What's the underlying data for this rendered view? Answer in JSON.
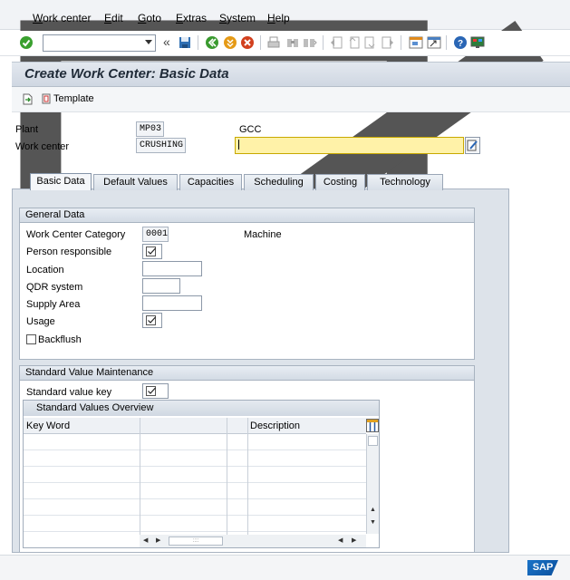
{
  "menu": {
    "items": [
      "Work center",
      "Edit",
      "Goto",
      "Extras",
      "System",
      "Help"
    ]
  },
  "toolbar": {
    "command_field_value": "",
    "icons": [
      "enter-icon",
      "command-dropdown-icon",
      "back-arrows-icon",
      "save-icon",
      "back-icon",
      "exit-icon",
      "cancel-icon",
      "print-icon",
      "find-icon",
      "find-next-icon",
      "first-page-icon",
      "prev-page-icon",
      "next-page-icon",
      "last-page-icon",
      "new-session-icon",
      "shortcut-icon",
      "help-icon",
      "customize-layout-icon"
    ]
  },
  "title": "Create Work Center: Basic Data",
  "app_toolbar": {
    "template_label": "Template"
  },
  "header": {
    "plant_label": "Plant",
    "plant_value": "MP03",
    "plant_text": "GCC",
    "work_center_label": "Work center",
    "work_center_value": "CRUSHING",
    "work_center_text": ""
  },
  "tabs": [
    {
      "label": "Basic Data",
      "active": true
    },
    {
      "label": "Default Values",
      "active": false
    },
    {
      "label": "Capacities",
      "active": false
    },
    {
      "label": "Scheduling",
      "active": false
    },
    {
      "label": "Costing",
      "active": false
    },
    {
      "label": "Technology",
      "active": false
    }
  ],
  "general_data": {
    "title": "General Data",
    "category_label": "Work Center Category",
    "category_value": "0001",
    "category_text": "Machine",
    "person_label": "Person responsible",
    "location_label": "Location",
    "location_value": "",
    "qdr_label": "QDR system",
    "qdr_value": "",
    "supply_label": "Supply Area",
    "supply_value": "",
    "usage_label": "Usage",
    "backflush_label": "Backflush",
    "backflush_checked": false
  },
  "standard_values": {
    "title": "Standard Value Maintenance",
    "key_label": "Standard value key",
    "overview_title": "Standard Values Overview",
    "columns": [
      "Key Word",
      "",
      "",
      "Description"
    ]
  },
  "footer": {
    "logo_text": "SAP"
  },
  "colors": {
    "required_field": "#fff2a8",
    "title_bar": "#cfd7e2",
    "accent_blue": "#0b4f9c"
  }
}
